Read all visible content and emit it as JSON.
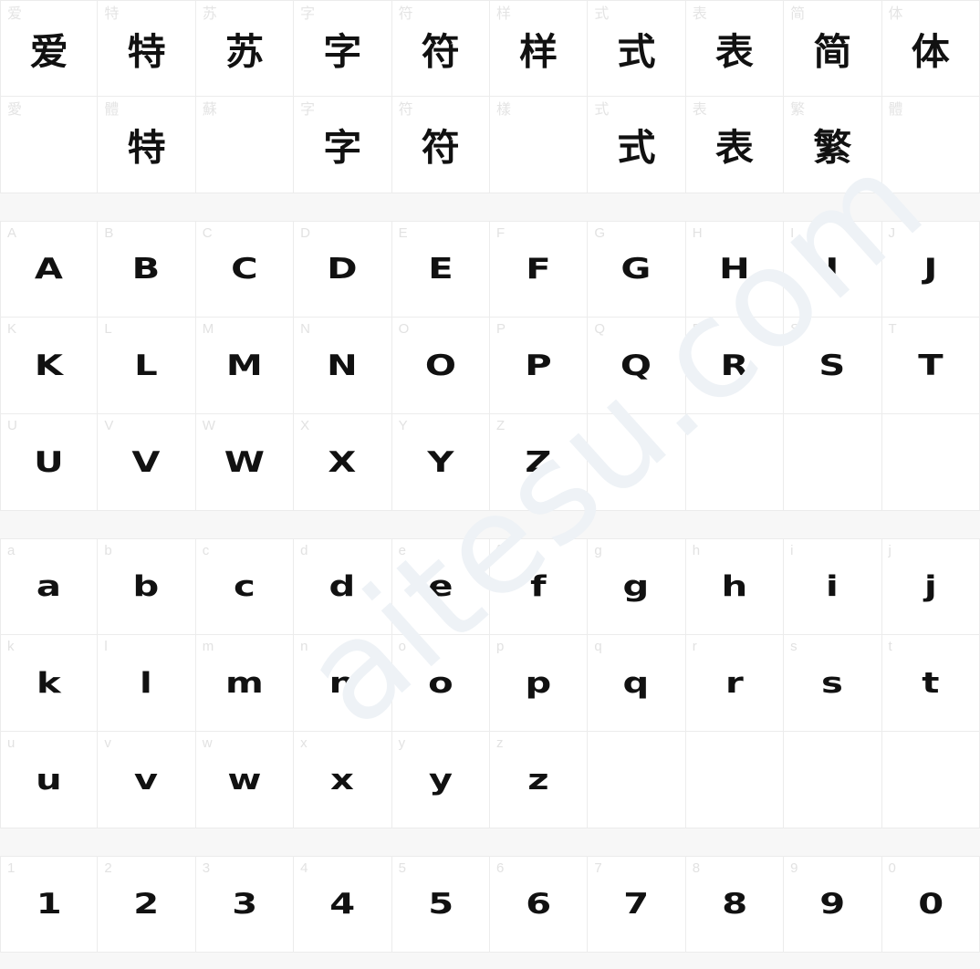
{
  "page": {
    "background_color": "#f7f7f7",
    "cell_background_color": "#ffffff",
    "grid_line_color": "#ececec",
    "label_color": "#e2e2e2",
    "glyph_color": "#111111",
    "columns": 10
  },
  "watermark": {
    "text": "aitesu.com",
    "color": "#eef2f6",
    "rotation_deg": -42
  },
  "sections": [
    {
      "name": "cjk-sample",
      "rows": [
        {
          "name": "simplified-sample",
          "cells": [
            {
              "label": "爱",
              "glyph": "爱",
              "script": "cjk"
            },
            {
              "label": "特",
              "glyph": "特",
              "script": "cjk"
            },
            {
              "label": "苏",
              "glyph": "苏",
              "script": "cjk"
            },
            {
              "label": "字",
              "glyph": "字",
              "script": "cjk"
            },
            {
              "label": "符",
              "glyph": "符",
              "script": "cjk"
            },
            {
              "label": "样",
              "glyph": "样",
              "script": "cjk"
            },
            {
              "label": "式",
              "glyph": "式",
              "script": "cjk"
            },
            {
              "label": "表",
              "glyph": "表",
              "script": "cjk"
            },
            {
              "label": "简",
              "glyph": "简",
              "script": "cjk"
            },
            {
              "label": "体",
              "glyph": "体",
              "script": "cjk"
            }
          ]
        },
        {
          "name": "traditional-sample",
          "cells": [
            {
              "label": "愛",
              "glyph": "",
              "script": "cjk"
            },
            {
              "label": "體",
              "glyph": "特",
              "script": "cjk"
            },
            {
              "label": "蘇",
              "glyph": "",
              "script": "cjk"
            },
            {
              "label": "字",
              "glyph": "字",
              "script": "cjk"
            },
            {
              "label": "符",
              "glyph": "符",
              "script": "cjk"
            },
            {
              "label": "樣",
              "glyph": "",
              "script": "cjk"
            },
            {
              "label": "式",
              "glyph": "式",
              "script": "cjk"
            },
            {
              "label": "表",
              "glyph": "表",
              "script": "cjk"
            },
            {
              "label": "繁",
              "glyph": "繁",
              "script": "cjk"
            },
            {
              "label": "體",
              "glyph": "",
              "script": "cjk"
            }
          ]
        }
      ]
    },
    {
      "name": "uppercase-latin",
      "rows": [
        {
          "name": "uppercase-a-j",
          "cells": [
            {
              "label": "A",
              "glyph": "A",
              "script": "latin"
            },
            {
              "label": "B",
              "glyph": "B",
              "script": "latin"
            },
            {
              "label": "C",
              "glyph": "C",
              "script": "latin"
            },
            {
              "label": "D",
              "glyph": "D",
              "script": "latin"
            },
            {
              "label": "E",
              "glyph": "E",
              "script": "latin"
            },
            {
              "label": "F",
              "glyph": "F",
              "script": "latin"
            },
            {
              "label": "G",
              "glyph": "G",
              "script": "latin"
            },
            {
              "label": "H",
              "glyph": "H",
              "script": "latin"
            },
            {
              "label": "I",
              "glyph": "I",
              "script": "latin"
            },
            {
              "label": "J",
              "glyph": "J",
              "script": "latin"
            }
          ]
        },
        {
          "name": "uppercase-k-t",
          "cells": [
            {
              "label": "K",
              "glyph": "K",
              "script": "latin"
            },
            {
              "label": "L",
              "glyph": "L",
              "script": "latin"
            },
            {
              "label": "M",
              "glyph": "M",
              "script": "latin"
            },
            {
              "label": "N",
              "glyph": "N",
              "script": "latin"
            },
            {
              "label": "O",
              "glyph": "O",
              "script": "latin"
            },
            {
              "label": "P",
              "glyph": "P",
              "script": "latin"
            },
            {
              "label": "Q",
              "glyph": "Q",
              "script": "latin"
            },
            {
              "label": "R",
              "glyph": "R",
              "script": "latin"
            },
            {
              "label": "S",
              "glyph": "S",
              "script": "latin"
            },
            {
              "label": "T",
              "glyph": "T",
              "script": "latin"
            }
          ]
        },
        {
          "name": "uppercase-u-z",
          "cells": [
            {
              "label": "U",
              "glyph": "U",
              "script": "latin"
            },
            {
              "label": "V",
              "glyph": "V",
              "script": "latin"
            },
            {
              "label": "W",
              "glyph": "W",
              "script": "latin"
            },
            {
              "label": "X",
              "glyph": "X",
              "script": "latin"
            },
            {
              "label": "Y",
              "glyph": "Y",
              "script": "latin"
            },
            {
              "label": "Z",
              "glyph": "Z",
              "script": "latin"
            },
            {
              "label": "",
              "glyph": "",
              "script": "latin"
            },
            {
              "label": "",
              "glyph": "",
              "script": "latin"
            },
            {
              "label": "",
              "glyph": "",
              "script": "latin"
            },
            {
              "label": "",
              "glyph": "",
              "script": "latin"
            }
          ]
        }
      ]
    },
    {
      "name": "lowercase-latin",
      "rows": [
        {
          "name": "lowercase-a-j",
          "cells": [
            {
              "label": "a",
              "glyph": "a",
              "script": "latin"
            },
            {
              "label": "b",
              "glyph": "b",
              "script": "latin"
            },
            {
              "label": "c",
              "glyph": "c",
              "script": "latin"
            },
            {
              "label": "d",
              "glyph": "d",
              "script": "latin"
            },
            {
              "label": "e",
              "glyph": "e",
              "script": "latin"
            },
            {
              "label": "f",
              "glyph": "f",
              "script": "latin"
            },
            {
              "label": "g",
              "glyph": "g",
              "script": "latin"
            },
            {
              "label": "h",
              "glyph": "h",
              "script": "latin"
            },
            {
              "label": "i",
              "glyph": "i",
              "script": "latin"
            },
            {
              "label": "j",
              "glyph": "j",
              "script": "latin"
            }
          ]
        },
        {
          "name": "lowercase-k-t",
          "cells": [
            {
              "label": "k",
              "glyph": "k",
              "script": "latin"
            },
            {
              "label": "l",
              "glyph": "l",
              "script": "latin"
            },
            {
              "label": "m",
              "glyph": "m",
              "script": "latin"
            },
            {
              "label": "n",
              "glyph": "n",
              "script": "latin"
            },
            {
              "label": "o",
              "glyph": "o",
              "script": "latin"
            },
            {
              "label": "p",
              "glyph": "p",
              "script": "latin"
            },
            {
              "label": "q",
              "glyph": "q",
              "script": "latin"
            },
            {
              "label": "r",
              "glyph": "r",
              "script": "latin"
            },
            {
              "label": "s",
              "glyph": "s",
              "script": "latin"
            },
            {
              "label": "t",
              "glyph": "t",
              "script": "latin"
            }
          ]
        },
        {
          "name": "lowercase-u-z",
          "cells": [
            {
              "label": "u",
              "glyph": "u",
              "script": "latin"
            },
            {
              "label": "v",
              "glyph": "v",
              "script": "latin"
            },
            {
              "label": "w",
              "glyph": "w",
              "script": "latin"
            },
            {
              "label": "x",
              "glyph": "x",
              "script": "latin"
            },
            {
              "label": "y",
              "glyph": "y",
              "script": "latin"
            },
            {
              "label": "z",
              "glyph": "z",
              "script": "latin"
            },
            {
              "label": "",
              "glyph": "",
              "script": "latin"
            },
            {
              "label": "",
              "glyph": "",
              "script": "latin"
            },
            {
              "label": "",
              "glyph": "",
              "script": "latin"
            },
            {
              "label": "",
              "glyph": "",
              "script": "latin"
            }
          ]
        }
      ]
    },
    {
      "name": "digits",
      "rows": [
        {
          "name": "digits-1-0",
          "cells": [
            {
              "label": "1",
              "glyph": "1",
              "script": "digit"
            },
            {
              "label": "2",
              "glyph": "2",
              "script": "digit"
            },
            {
              "label": "3",
              "glyph": "3",
              "script": "digit"
            },
            {
              "label": "4",
              "glyph": "4",
              "script": "digit"
            },
            {
              "label": "5",
              "glyph": "5",
              "script": "digit"
            },
            {
              "label": "6",
              "glyph": "6",
              "script": "digit"
            },
            {
              "label": "7",
              "glyph": "7",
              "script": "digit"
            },
            {
              "label": "8",
              "glyph": "8",
              "script": "digit"
            },
            {
              "label": "9",
              "glyph": "9",
              "script": "digit"
            },
            {
              "label": "0",
              "glyph": "0",
              "script": "digit"
            }
          ]
        }
      ]
    }
  ]
}
